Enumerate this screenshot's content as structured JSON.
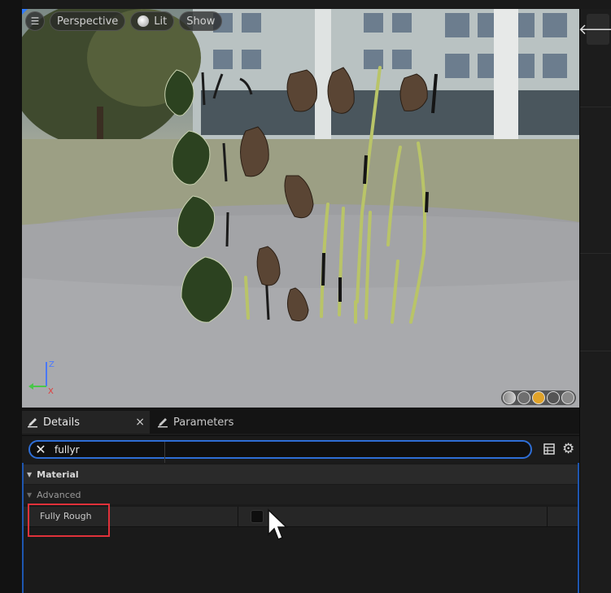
{
  "viewport": {
    "menu_icon": "hamburger-icon",
    "perspective_label": "Perspective",
    "lit_label": "Lit",
    "show_label": "Show",
    "axis_z": "Z",
    "axis_x": "X"
  },
  "details": {
    "tabs": [
      {
        "label": "Details",
        "icon": "pencil-icon",
        "active": true
      },
      {
        "label": "Parameters",
        "icon": "pencil-icon",
        "active": false
      }
    ],
    "tab_close": "×",
    "search": {
      "value": "fullyr",
      "clear": "✕"
    },
    "category": {
      "label": "Material"
    },
    "subcategory": {
      "label": "Advanced"
    },
    "property": {
      "label": "Fully Rough",
      "checked": false
    },
    "settings_icon": "⚙"
  },
  "right_panel": {
    "back_arrow": "🡐"
  },
  "colors": {
    "accent_blue": "#2e6ed6",
    "highlight_red": "#e0313a"
  }
}
